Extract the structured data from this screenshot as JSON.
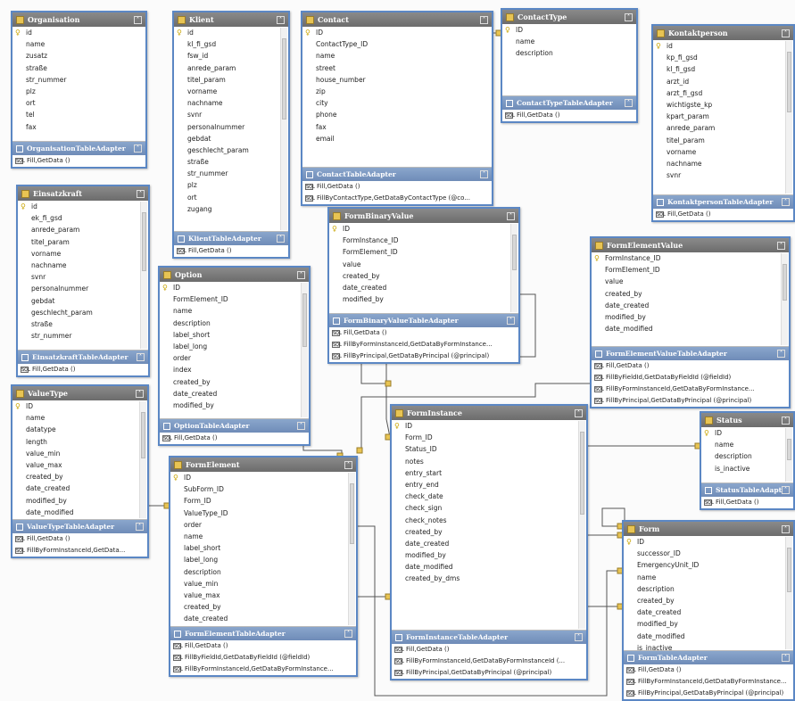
{
  "tables": [
    {
      "name": "Organisation",
      "fields": [
        "id",
        "name",
        "zusatz",
        "straße",
        "str_nummer",
        "plz",
        "ort",
        "tel",
        "fax"
      ],
      "adapter": "OrganisationTableAdapter",
      "methods": [
        "Fill,GetData ()"
      ]
    },
    {
      "name": "Einsatzkraft",
      "fields": [
        "id",
        "ek_fi_gsd",
        "anrede_param",
        "titel_param",
        "vorname",
        "nachname",
        "svnr",
        "personalnummer",
        "gebdat",
        "geschlecht_param",
        "straße",
        "str_nummer"
      ],
      "adapter": "EinsatzkraftTableAdapter",
      "methods": [
        "Fill,GetData ()"
      ]
    },
    {
      "name": "ValueType",
      "fields": [
        "ID",
        "name",
        "datatype",
        "length",
        "value_min",
        "value_max",
        "created_by",
        "date_created",
        "modified_by",
        "date_modified"
      ],
      "adapter": "ValueTypeTableAdapter",
      "methods": [
        "Fill,GetData ()",
        "FillByFormInstanceId,GetData..."
      ]
    },
    {
      "name": "Klient",
      "fields": [
        "id",
        "kl_fi_gsd",
        "fsw_id",
        "anrede_param",
        "titel_param",
        "vorname",
        "nachname",
        "svnr",
        "personalnummer",
        "gebdat",
        "geschlecht_param",
        "straße",
        "str_nummer",
        "plz",
        "ort",
        "zugang"
      ],
      "adapter": "KlientTableAdapter",
      "methods": [
        "Fill,GetData ()"
      ]
    },
    {
      "name": "Option",
      "fields": [
        "ID",
        "FormElement_ID",
        "name",
        "description",
        "label_short",
        "label_long",
        "order",
        "index",
        "created_by",
        "date_created",
        "modified_by"
      ],
      "adapter": "OptionTableAdapter",
      "methods": [
        "Fill,GetData ()"
      ]
    },
    {
      "name": "FormElement",
      "fields": [
        "ID",
        "SubForm_ID",
        "Form_ID",
        "ValueType_ID",
        "order",
        "name",
        "label_short",
        "label_long",
        "description",
        "value_min",
        "value_max",
        "created_by",
        "date_created"
      ],
      "adapter": "FormElementTableAdapter",
      "methods": [
        "Fill,GetData ()",
        "FillByFieldId,GetDataByFieldId (@fieldId)",
        "FillByFormInstanceId,GetDataByFormInstance..."
      ]
    },
    {
      "name": "Contact",
      "fields": [
        "ID",
        "ContactType_ID",
        "name",
        "street",
        "house_number",
        "zip",
        "city",
        "phone",
        "fax",
        "email"
      ],
      "adapter": "ContactTableAdapter",
      "methods": [
        "Fill,GetData ()",
        "FillByContactType,GetDataByContactType (@co..."
      ]
    },
    {
      "name": "ContactType",
      "fields": [
        "ID",
        "name",
        "description"
      ],
      "adapter": "ContactTypeTableAdapter",
      "methods": [
        "Fill,GetData ()"
      ]
    },
    {
      "name": "Kontaktperson",
      "fields": [
        "id",
        "kp_fi_gsd",
        "kl_fi_gsd",
        "arzt_id",
        "arzt_fi_gsd",
        "wichtigste_kp",
        "kpart_param",
        "anrede_param",
        "titel_param",
        "vorname",
        "nachname",
        "svnr"
      ],
      "adapter": "KontaktpersonTableAdapter",
      "methods": [
        "Fill,GetData ()"
      ]
    },
    {
      "name": "FormBinaryValue",
      "fields": [
        "ID",
        "FormInstance_ID",
        "FormElement_ID",
        "value",
        "created_by",
        "date_created",
        "modified_by"
      ],
      "adapter": "FormBinaryValueTableAdapter",
      "methods": [
        "Fill,GetData ()",
        "FillByFormInstanceId,GetDataByFormInstance...",
        "FillByPrincipal,GetDataByPrincipal (@principal)"
      ]
    },
    {
      "name": "FormElementValue",
      "fields": [
        "FormInstance_ID",
        "FormElement_ID",
        "value",
        "created_by",
        "date_created",
        "modified_by",
        "date_modified"
      ],
      "adapter": "FormElementValueTableAdapter",
      "methods": [
        "Fill,GetData ()",
        "FillByFieldId,GetDataByFieldId (@fieldId)",
        "FillByFormInstanceId,GetDataByFormInstance...",
        "FillByPrincipal,GetDataByPrincipal (@principal)"
      ]
    },
    {
      "name": "FormInstance",
      "fields": [
        "ID",
        "Form_ID",
        "Status_ID",
        "notes",
        "entry_start",
        "entry_end",
        "check_date",
        "check_sign",
        "check_notes",
        "created_by",
        "date_created",
        "modified_by",
        "date_modified",
        "created_by_dms"
      ],
      "adapter": "FormInstanceTableAdapter",
      "methods": [
        "Fill,GetData ()",
        "FillByFormInstanceId,GetDataByFormInstanceId (...",
        "FillByPrincipal,GetDataByPrincipal (@principal)"
      ]
    },
    {
      "name": "Status",
      "fields": [
        "ID",
        "name",
        "description",
        "is_inactive"
      ],
      "adapter": "StatusTableAdapter",
      "methods": [
        "Fill,GetData ()"
      ]
    },
    {
      "name": "Form",
      "fields": [
        "ID",
        "successor_ID",
        "EmergencyUnit_ID",
        "name",
        "description",
        "created_by",
        "date_created",
        "modified_by",
        "date_modified",
        "is_inactive"
      ],
      "adapter": "FormTableAdapter",
      "methods": [
        "Fill,GetData ()",
        "FillByFormInstanceId,GetDataByFormInstance...",
        "FillByPrincipal,GetDataByPrincipal (@principal)"
      ]
    }
  ],
  "colors": {
    "table_border": "#5b87c4",
    "header_bg": "#7b7b7b",
    "adapter_bg": "#7f9cc4",
    "key_icon": "#c9a400",
    "relation_line": "#555555"
  },
  "icons": {
    "table": "table-icon",
    "key": "primary-key-icon",
    "collapse": "chevron-up-icon",
    "method": "query-method-icon",
    "relation": "relation-infinity-icon"
  }
}
